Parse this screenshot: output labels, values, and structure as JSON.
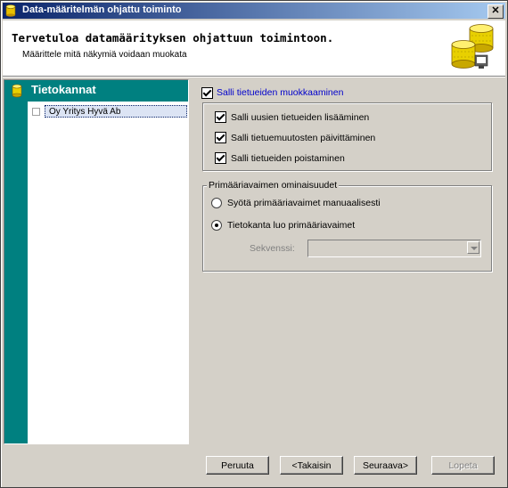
{
  "window": {
    "title": "Data-määritelmän ohjattu toiminto",
    "close_label": "✕"
  },
  "header": {
    "title": "Tervetuloa datamäärityksen ohjattuun toimintoon.",
    "subtitle": "Määrittele mitä näkymiä voidaan muokata"
  },
  "sidebar": {
    "title": "Tietokannat",
    "tree_items": [
      {
        "label": "Oy Yritys Hyvä Ab",
        "selected": true
      }
    ]
  },
  "options": {
    "allow_edit": {
      "label": "Salli tietueiden muokkaaminen",
      "checked": true
    },
    "allow_add": {
      "label": "Salli uusien tietueiden lisääminen",
      "checked": true
    },
    "allow_update": {
      "label": "Salli tietuemuutosten päivittäminen",
      "checked": true
    },
    "allow_delete": {
      "label": "Salli tietueiden poistaminen",
      "checked": true
    }
  },
  "primary_key": {
    "group_title": "Primääriavaimen ominaisuudet",
    "manual": {
      "label": "Syötä primääriavaimet manuaalisesti",
      "selected": false
    },
    "db_generated": {
      "label": "Tietokanta luo primääriavaimet",
      "selected": true
    },
    "sequence_label": "Sekvenssi:",
    "sequence_value": ""
  },
  "buttons": {
    "cancel": "Peruuta",
    "back": "<Takaisin",
    "next": "Seuraava>",
    "finish": "Lopeta"
  },
  "colors": {
    "title_gradient_start": "#0a246a",
    "title_gradient_end": "#a6caf0",
    "sidebar_bg": "#008080",
    "link_blue": "#0000cc"
  }
}
